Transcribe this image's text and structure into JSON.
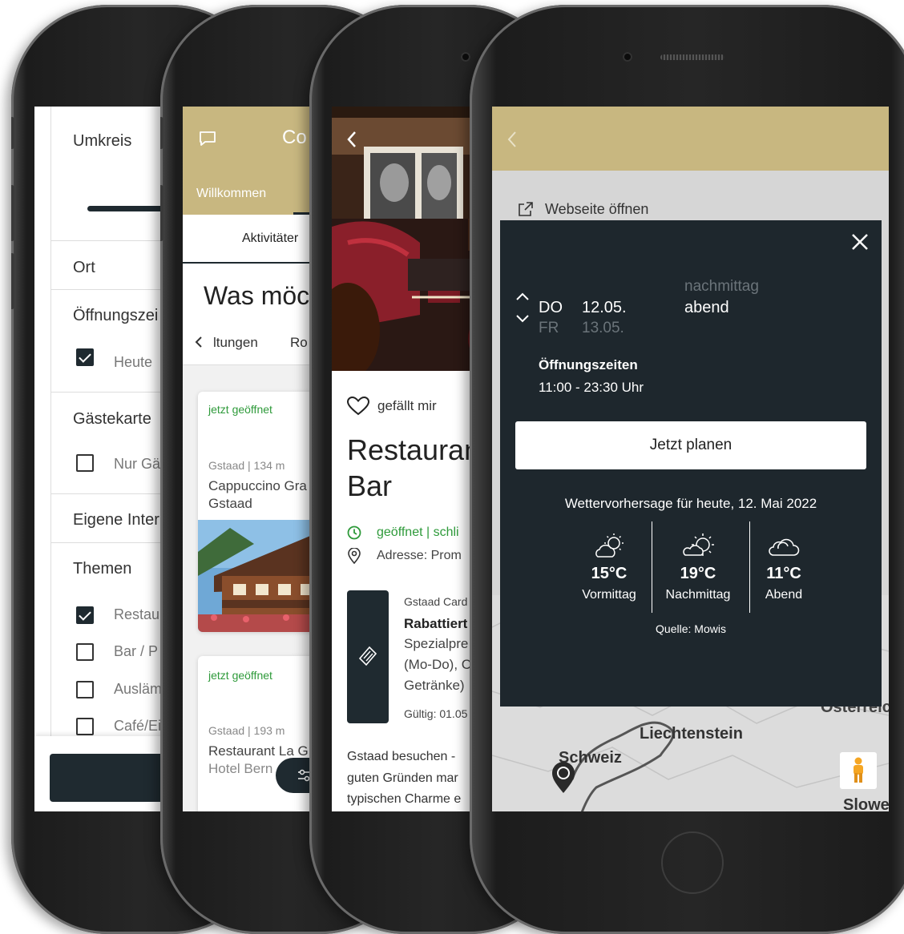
{
  "phone1": {
    "umkreis_label": "Umkreis",
    "ort_label": "Ort",
    "oeffnungszeiten_label": "Öffnungszei",
    "heute_label": "Heute",
    "gaestekarte_label": "Gästekarte",
    "nur_gaestekarte_label": "Nur Gä",
    "eigene_interessen_label": "Eigene Inter",
    "themen_label": "Themen",
    "themen_items": [
      {
        "label": "Restau",
        "checked": true
      },
      {
        "label": "Bar / P",
        "checked": false
      },
      {
        "label": "Ausläm",
        "checked": false
      },
      {
        "label": "Café/Ei",
        "checked": false
      }
    ]
  },
  "phone2": {
    "header_title": "Co",
    "tab_willkommen": "Willkommen",
    "tab_aktivitaeten": "Aktivitäter",
    "heading": "Was möc",
    "chips": [
      "ltungen",
      "Ro"
    ],
    "cards": [
      {
        "status": "jetzt geöffnet",
        "meta": "Gstaad | 134 m",
        "title": "Cappuccino Gra",
        "subtitle": "Gstaad"
      },
      {
        "status": "jetzt geöffnet",
        "meta": "Gstaad | 193 m",
        "title": "Restaurant La G",
        "subtitle": "Hotel Bern"
      }
    ],
    "accent_color": "#c8b780",
    "status_color": "#2e9a3a"
  },
  "phone3": {
    "like_label": "gefällt mir",
    "title_line1": "Restauran",
    "title_line2": "Bar",
    "open_status": "geöffnet | schli",
    "address": "Adresse: Prom",
    "card_title": "Gstaad Card",
    "card_heading": "Rabattiert",
    "card_lines": [
      "Spezialpre",
      "(Mo-Do), C",
      "Getränke)"
    ],
    "card_valid": "Gültig: 01.05",
    "desc_lines": [
      "Gstaad besuchen -",
      "guten Gründen mar",
      "typischen Charme e"
    ]
  },
  "phone4": {
    "website_label": "Webseite öffnen",
    "days": [
      {
        "day": "DO",
        "date": "12.05.",
        "active": true
      },
      {
        "day": "FR",
        "date": "13.05.",
        "active": false
      }
    ],
    "periods": [
      {
        "label": "nachmittag",
        "active": false
      },
      {
        "label": "abend",
        "active": true
      }
    ],
    "hours_title": "Öffnungszeiten",
    "hours_value": "11:00 - 23:30 Uhr",
    "plan_button": "Jetzt planen",
    "forecast_title": "Wettervorhersage für heute, 12. Mai 2022",
    "weather": [
      {
        "icon": "partly-sunny-icon",
        "temp": "15°C",
        "label": "Vormittag"
      },
      {
        "icon": "sunny-cloud-icon",
        "temp": "19°C",
        "label": "Nachmittag"
      },
      {
        "icon": "cloud-icon",
        "temp": "11°C",
        "label": "Abend"
      }
    ],
    "source": "Quelle: Mowis",
    "map_labels": [
      "Liechtenstein",
      "Schweiz",
      "Österreich",
      "Slowe"
    ],
    "header_color": "#c8b780",
    "dialog_color": "#1e272d"
  }
}
